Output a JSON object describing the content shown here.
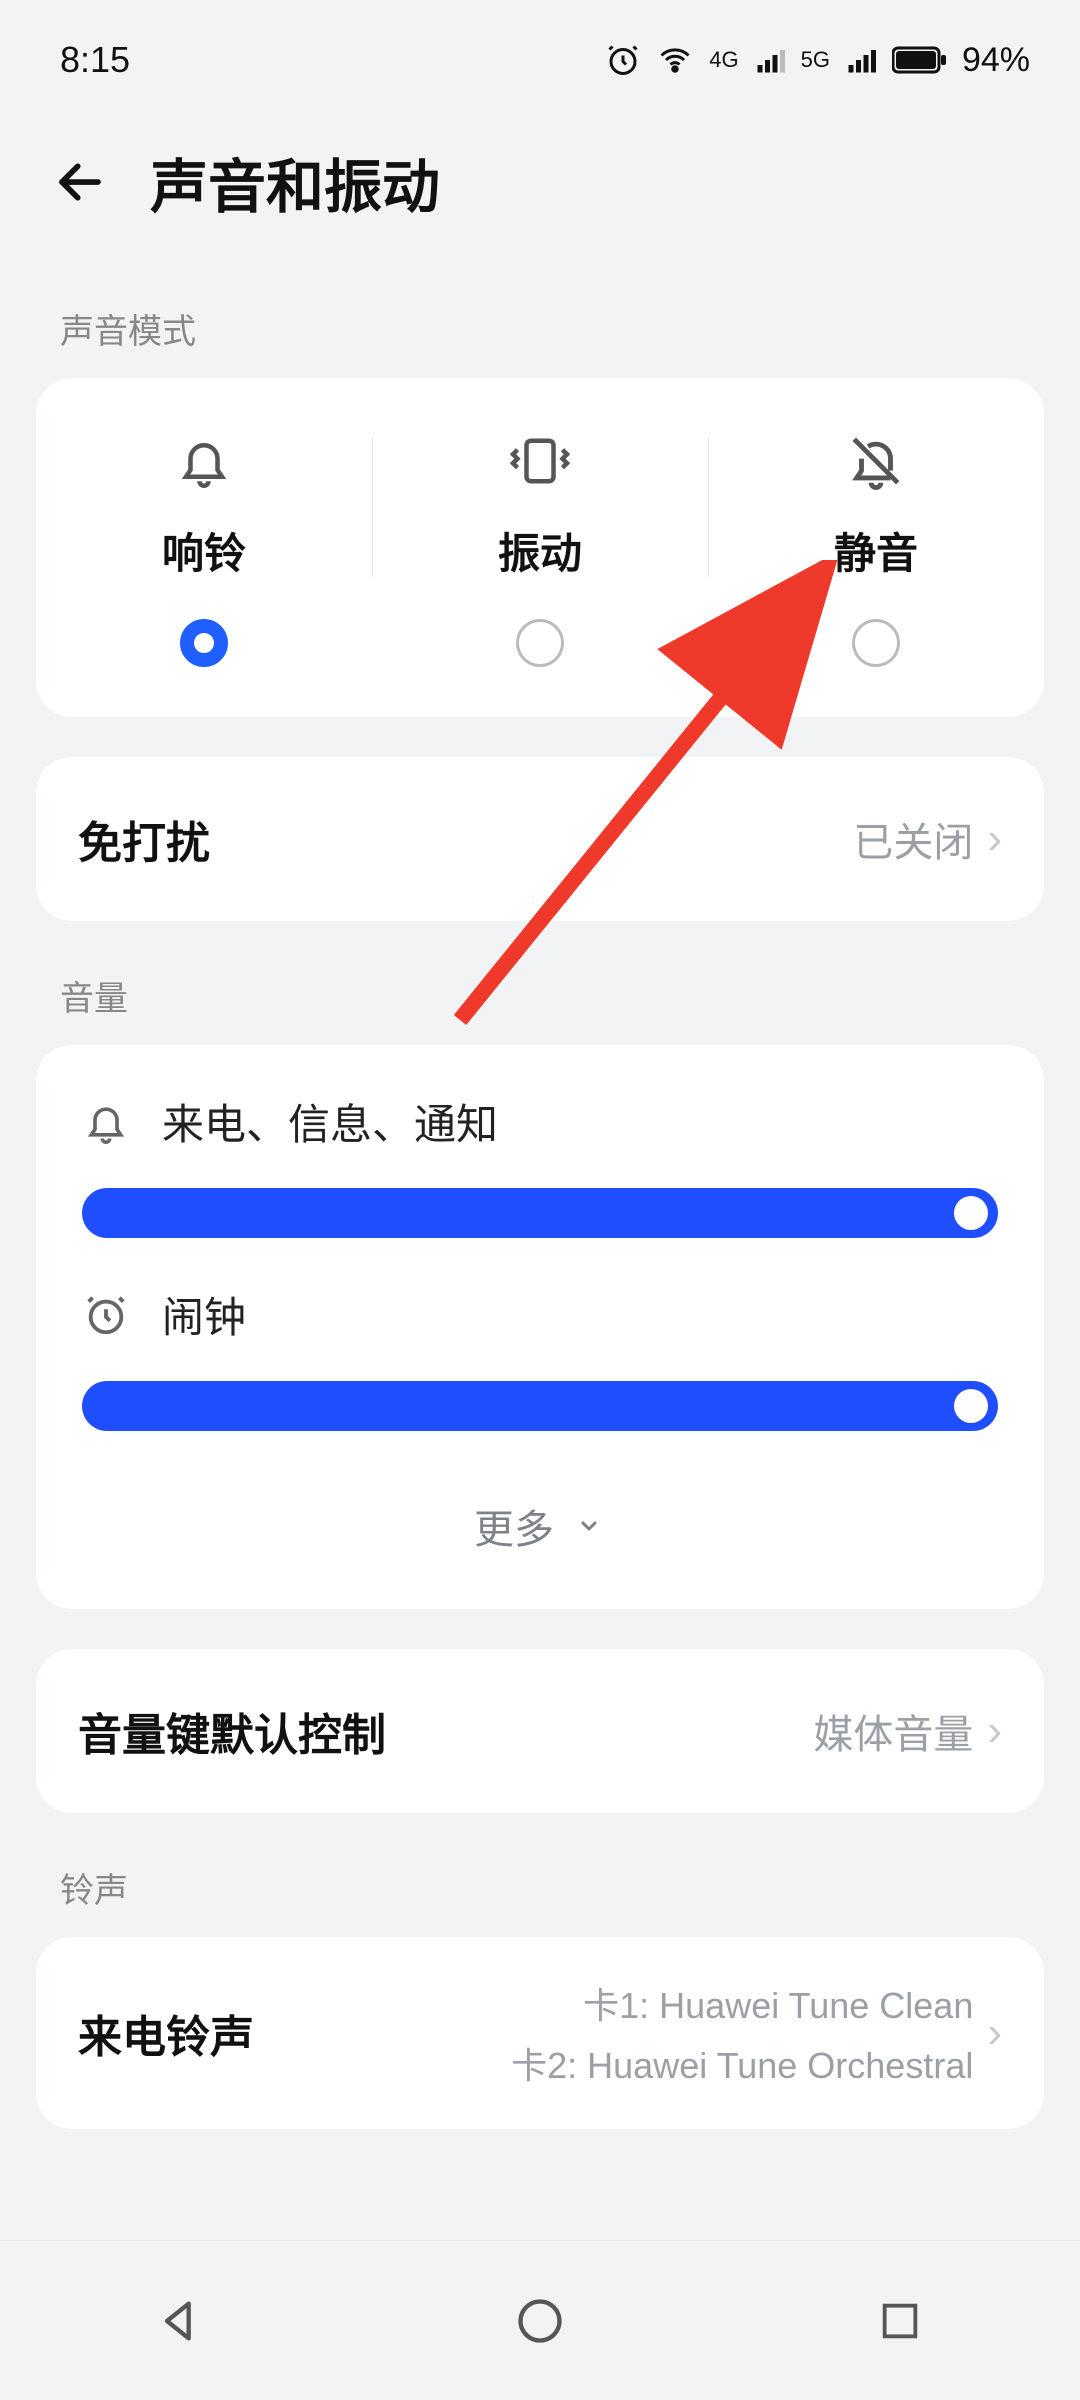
{
  "status": {
    "time": "8:15",
    "net1_label": "4G",
    "net2_label": "5G",
    "battery": "94%"
  },
  "header": {
    "title": "声音和振动"
  },
  "sections": {
    "sound_mode_label": "声音模式",
    "volume_label": "音量",
    "ringtone_label": "铃声"
  },
  "modes": {
    "ring": "响铃",
    "vibrate": "振动",
    "silent": "静音",
    "selected": "ring"
  },
  "dnd": {
    "title": "免打扰",
    "value": "已关闭"
  },
  "volume": {
    "ring_label": "来电、信息、通知",
    "alarm_label": "闹钟",
    "more_label": "更多"
  },
  "vol_key": {
    "title": "音量键默认控制",
    "value": "媒体音量"
  },
  "ringtone": {
    "title": "来电铃声",
    "sim1": "卡1: Huawei Tune Clean",
    "sim2": "卡2: Huawei Tune Orchestral"
  }
}
